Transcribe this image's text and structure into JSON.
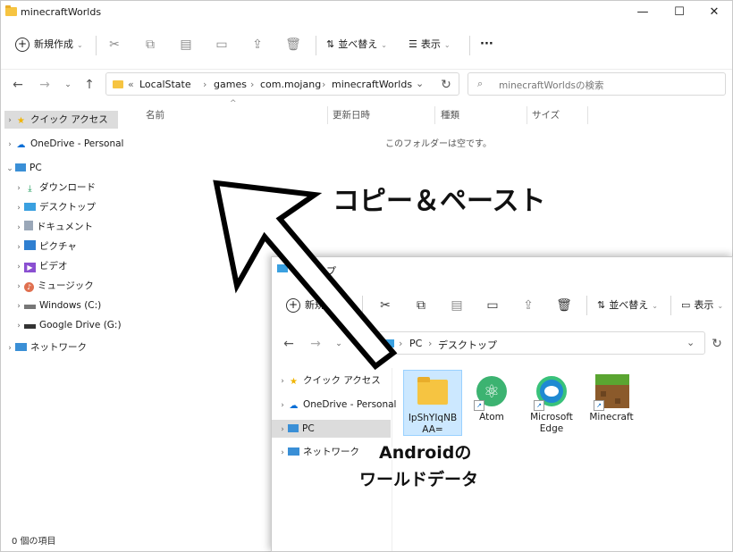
{
  "window_main": {
    "title": "minecraftWorlds",
    "controls": {
      "minimize": "—",
      "maximize": "☐",
      "close": "✕"
    },
    "toolbar": {
      "new_label": "新規作成",
      "sort_label": "並べ替え",
      "view_label": "表示",
      "more_label": "···"
    },
    "breadcrumb": [
      "LocalState",
      "games",
      "com.mojang",
      "minecraftWorlds"
    ],
    "breadcrumb_prefix": "«",
    "search_placeholder": "minecraftWorldsの検索",
    "sidebar": {
      "quick_access": "クイック アクセス",
      "onedrive": "OneDrive - Personal",
      "pc": "PC",
      "pc_children": [
        "ダウンロード",
        "デスクトップ",
        "ドキュメント",
        "ピクチャ",
        "ビデオ",
        "ミュージック",
        "Windows (C:)",
        "Google Drive (G:)"
      ],
      "network": "ネットワーク"
    },
    "columns": [
      "名前",
      "更新日時",
      "種類",
      "サイズ"
    ],
    "empty_message": "このフォルダーは空です。",
    "status": "0 個の項目"
  },
  "window_second": {
    "title_fragment": "ップ",
    "toolbar": {
      "new_label": "新規",
      "sort_label": "並べ替え",
      "view_label": "表示"
    },
    "breadcrumb": [
      "PC",
      "デスクトップ"
    ],
    "sidebar": {
      "quick_access": "クイック アクセス",
      "onedrive": "OneDrive - Personal",
      "pc": "PC",
      "network": "ネットワーク"
    },
    "files": [
      {
        "line1": "IpShYIqNB",
        "line2": "AA="
      },
      {
        "line1": "Atom",
        "line2": ""
      },
      {
        "line1": "Microsoft",
        "line2": "Edge"
      },
      {
        "line1": "Minecraft",
        "line2": ""
      }
    ]
  },
  "annotations": {
    "copy_paste": "コピー＆ペースト",
    "android_line1": "Androidの",
    "android_line2": "ワールドデータ"
  },
  "colors": {
    "folder": "#f6c441",
    "selection": "#cce8ff",
    "accent": "#0067c0"
  }
}
